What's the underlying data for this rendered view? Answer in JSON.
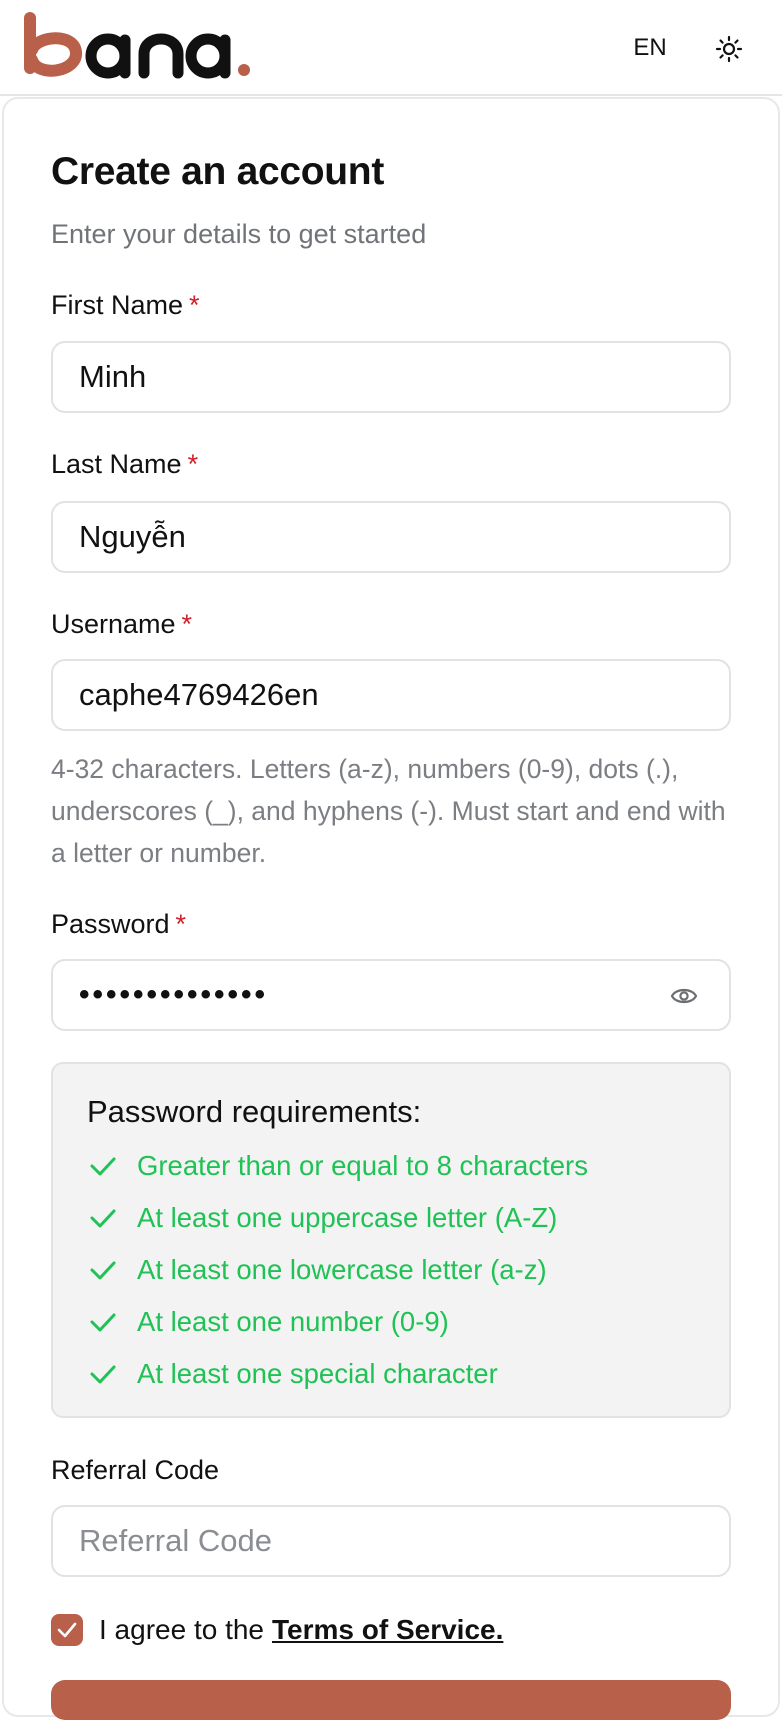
{
  "header": {
    "logo_text": "bana.",
    "language": "EN",
    "theme_icon": "sun-icon"
  },
  "form": {
    "title": "Create an account",
    "subtitle": "Enter your details to get started",
    "required_marker": "*",
    "first_name": {
      "label": "First Name",
      "value": "Minh"
    },
    "last_name": {
      "label": "Last Name",
      "value": "Nguyễn"
    },
    "username": {
      "label": "Username",
      "value": "caphe4769426en",
      "hint": "4-32 characters. Letters (a-z), numbers (0-9), dots (.), underscores (_), and hyphens (-). Must start and end with a letter or number."
    },
    "password": {
      "label": "Password",
      "masked_value": "••••••••••••••",
      "visibility_icon": "eye-icon"
    },
    "password_requirements": {
      "title": "Password requirements:",
      "items": [
        {
          "text": "Greater than or equal to 8 characters",
          "met": true
        },
        {
          "text": "At least one uppercase letter (A-Z)",
          "met": true
        },
        {
          "text": "At least one lowercase letter (a-z)",
          "met": true
        },
        {
          "text": "At least one number (0-9)",
          "met": true
        },
        {
          "text": "At least one special character",
          "met": true
        }
      ]
    },
    "referral": {
      "label": "Referral Code",
      "placeholder": "Referral Code",
      "value": ""
    },
    "agree": {
      "checked": true,
      "text": "I agree to the",
      "link": "Terms of Service."
    }
  },
  "colors": {
    "brand": "#b9604a",
    "success": "#1fc254",
    "required": "#d0202a"
  }
}
